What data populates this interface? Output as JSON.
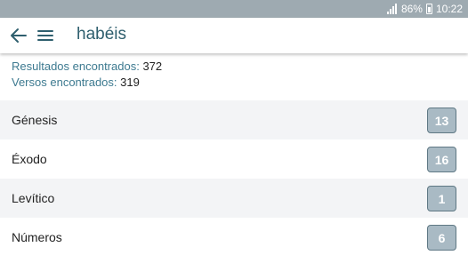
{
  "status_bar": {
    "battery": "86%",
    "time": "10:22"
  },
  "toolbar": {
    "search_term": "habéis"
  },
  "summary": {
    "results_label": "Resultados encontrados:",
    "results_value": "372",
    "verses_label": "Versos encontrados:",
    "verses_value": "319"
  },
  "books": [
    {
      "name": "Génesis",
      "count": "13"
    },
    {
      "name": "Éxodo",
      "count": "16"
    },
    {
      "name": "Levítico",
      "count": "1"
    },
    {
      "name": "Números",
      "count": "6"
    }
  ],
  "colors": {
    "status_bar": "#9eaab1",
    "accent_text": "#3d7a90",
    "badge_fill": "#a9bac4",
    "badge_border": "#5f7884"
  },
  "icons": {
    "back": "arrow-left-icon",
    "menu": "hamburger-menu-icon",
    "signal": "signal-icon",
    "battery": "battery-icon"
  }
}
